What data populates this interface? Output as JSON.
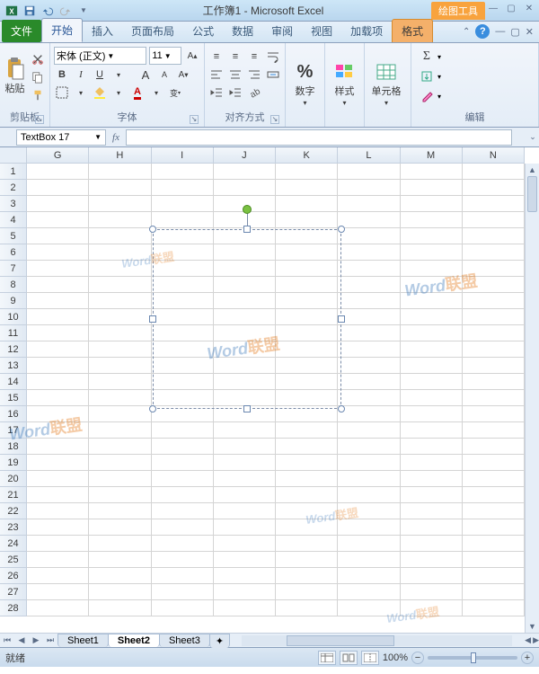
{
  "title": "工作簿1 - Microsoft Excel",
  "contextual_tab_group": "绘图工具",
  "tabs": {
    "file": "文件",
    "home": "开始",
    "insert": "插入",
    "layout": "页面布局",
    "formulas": "公式",
    "data": "数据",
    "review": "审阅",
    "view": "视图",
    "addins": "加载项",
    "format": "格式"
  },
  "ribbon": {
    "clipboard": {
      "paste": "粘贴",
      "label": "剪贴板"
    },
    "font": {
      "name": "宋体 (正文)",
      "size": "11",
      "label": "字体",
      "bold": "B",
      "italic": "I",
      "underline": "U"
    },
    "align": {
      "label": "对齐方式"
    },
    "number": {
      "btn": "数字",
      "percent": "%"
    },
    "styles": {
      "btn": "样式"
    },
    "cells": {
      "btn": "单元格"
    },
    "editing": {
      "label": "编辑"
    }
  },
  "namebox": "TextBox 17",
  "fx": "fx",
  "columns": [
    "G",
    "H",
    "I",
    "J",
    "K",
    "L",
    "M",
    "N"
  ],
  "row_start": 1,
  "row_end": 28,
  "sheets": {
    "s1": "Sheet1",
    "s2": "Sheet2",
    "s3": "Sheet3"
  },
  "status": {
    "ready": "就绪",
    "zoom": "100%"
  },
  "watermark_a": "Word",
  "watermark_b": "联盟"
}
